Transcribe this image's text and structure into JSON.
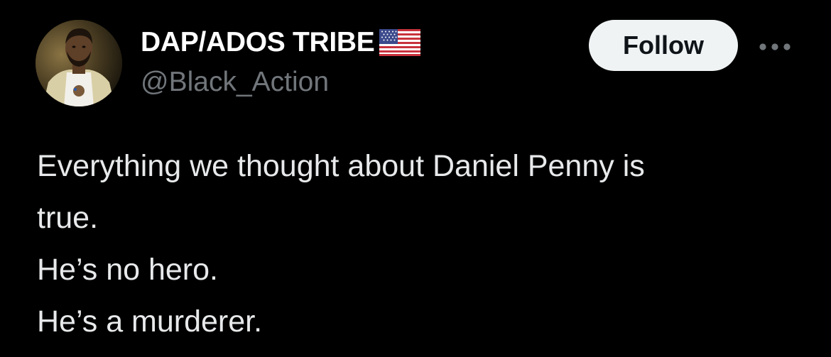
{
  "tweet": {
    "author": {
      "display_name": "DAP/ADOS TRIBE",
      "badge_icon": "us-flag-icon",
      "handle": "@Black_Action",
      "avatar_icon": "avatar-photo"
    },
    "follow_label": "Follow",
    "more_icon": "more-horizontal-icon",
    "text_lines": [
      "Everything we thought about Daniel Penny is",
      "true.",
      "He’s no hero.",
      "He’s a murderer."
    ]
  },
  "colors": {
    "background": "#000000",
    "primary_text": "#e7e9ea",
    "secondary_text": "#71767b",
    "follow_bg": "#eff3f4",
    "follow_text": "#0f1419"
  }
}
